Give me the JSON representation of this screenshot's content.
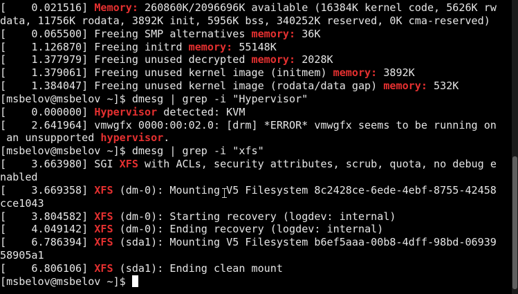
{
  "terminal": {
    "prompt": "[msbelov@msbelov ~]$ ",
    "lines": [
      [
        {
          "t": "[    0.021516] "
        },
        {
          "t": "Memory:",
          "c": "red"
        },
        {
          "t": " 260860K/2096696K available (16384K kernel code, 5626K rw"
        }
      ],
      [
        {
          "t": "data, 11756K rodata, 3892K init, 5956K bss, 340252K reserved, 0K cma-reserved)"
        }
      ],
      [
        {
          "t": "[    0.065500] Freeing SMP alternatives "
        },
        {
          "t": "memory:",
          "c": "red"
        },
        {
          "t": " 36K"
        }
      ],
      [
        {
          "t": "[    1.126870] Freeing initrd "
        },
        {
          "t": "memory:",
          "c": "red"
        },
        {
          "t": " 55148K"
        }
      ],
      [
        {
          "t": "[    1.377979] Freeing unused decrypted "
        },
        {
          "t": "memory:",
          "c": "red"
        },
        {
          "t": " 2028K"
        }
      ],
      [
        {
          "t": "[    1.379061] Freeing unused kernel image (initmem) "
        },
        {
          "t": "memory:",
          "c": "red"
        },
        {
          "t": " 3892K"
        }
      ],
      [
        {
          "t": "[    1.384047] Freeing unused kernel image (rodata/data gap) "
        },
        {
          "t": "memory:",
          "c": "red"
        },
        {
          "t": " 532K"
        }
      ],
      [
        {
          "t": "[msbelov@msbelov ~]$ dmesg | grep -i \"Hypervisor\""
        }
      ],
      [
        {
          "t": "[    0.000000] "
        },
        {
          "t": "Hypervisor",
          "c": "red"
        },
        {
          "t": " detected: KVM"
        }
      ],
      [
        {
          "t": "[    2.641964] vmwgfx 0000:00:02.0: [drm] *ERROR* vmwgfx seems to be running on"
        }
      ],
      [
        {
          "t": " an unsupported "
        },
        {
          "t": "hypervisor",
          "c": "red"
        },
        {
          "t": "."
        }
      ],
      [
        {
          "t": "[msbelov@msbelov ~]$ dmesg | grep -i \"xfs\""
        }
      ],
      [
        {
          "t": "[    3.663980] SGI "
        },
        {
          "t": "XFS",
          "c": "red"
        },
        {
          "t": " with ACLs, security attributes, scrub, quota, no debug e"
        }
      ],
      [
        {
          "t": "nabled"
        }
      ],
      [
        {
          "t": "[    3.669358] "
        },
        {
          "t": "XFS",
          "c": "red"
        },
        {
          "t": " (dm-0): Mounting V5 Filesystem 8c2428ce-6ede-4ebf-8755-42458"
        }
      ],
      [
        {
          "t": "cce1043"
        }
      ],
      [
        {
          "t": "[    3.804582] "
        },
        {
          "t": "XFS",
          "c": "red"
        },
        {
          "t": " (dm-0): Starting recovery (logdev: internal)"
        }
      ],
      [
        {
          "t": "[    4.049142] "
        },
        {
          "t": "XFS",
          "c": "red"
        },
        {
          "t": " (dm-0): Ending recovery (logdev: internal)"
        }
      ],
      [
        {
          "t": "[    6.786394] "
        },
        {
          "t": "XFS",
          "c": "red"
        },
        {
          "t": " (sda1): Mounting V5 Filesystem b6ef5aaa-00b8-4dff-98bd-06939"
        }
      ],
      [
        {
          "t": "58905a1"
        }
      ],
      [
        {
          "t": "[    6.806106] "
        },
        {
          "t": "XFS",
          "c": "red"
        },
        {
          "t": " (sda1): Ending clean mount"
        }
      ]
    ]
  },
  "colors": {
    "background": "#000000",
    "text": "#e6e6e6",
    "match_highlight": "#e53030"
  }
}
